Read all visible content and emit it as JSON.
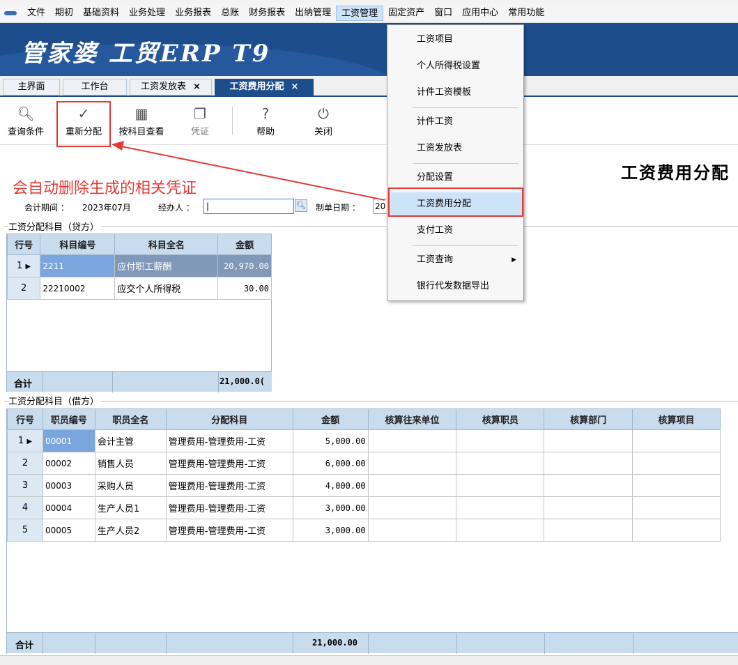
{
  "menubar": {
    "items": [
      "文件",
      "期初",
      "基础资料",
      "业务处理",
      "业务报表",
      "总账",
      "财务报表",
      "出纳管理",
      "工资管理",
      "固定资产",
      "窗口",
      "应用中心",
      "常用功能"
    ],
    "active": "工资管理"
  },
  "banner": {
    "brand": "管家婆 工贸ERP T9"
  },
  "tabs": [
    {
      "label": "主界面",
      "closable": false
    },
    {
      "label": "工作台",
      "closable": false
    },
    {
      "label": "工资发放表",
      "closable": true
    },
    {
      "label": "工资费用分配",
      "closable": true,
      "active": true
    }
  ],
  "tab_close_glyph": "×",
  "toolbar": {
    "query": "查询条件",
    "realloc": "重新分配",
    "by_subject": "按科目查看",
    "voucher": "凭证",
    "help": "帮助",
    "close": "关闭"
  },
  "page_title": "工资费用分配",
  "annotation": "会自动删除生成的相关凭证",
  "form": {
    "period_label": "会计期间 ：",
    "period_value": "2023年07月",
    "handler_label": "经办人 ：",
    "handler_value": "|",
    "date_label": "制单日期 ：",
    "date_value": "20"
  },
  "credit": {
    "title": "工资分配科目（贷方）",
    "headers": [
      "行号",
      "科目编号",
      "科目全名",
      "金额"
    ],
    "rows": [
      {
        "no": "1",
        "code": "2211",
        "name": "应付职工薪酬",
        "amount": "20,970.00"
      },
      {
        "no": "2",
        "code": "22210002",
        "name": "应交个人所得税",
        "amount": "30.00"
      }
    ],
    "total_label": "合计",
    "total_amount": "21,000.0("
  },
  "debit": {
    "title": "工资分配科目（借方）",
    "headers": [
      "行号",
      "职员编号",
      "职员全名",
      "分配科目",
      "金额",
      "核算往来单位",
      "核算职员",
      "核算部门",
      "核算项目"
    ],
    "rows": [
      {
        "no": "1",
        "code": "00001",
        "name": "会计主管",
        "subject": "管理费用-管理费用-工资",
        "amount": "5,000.00"
      },
      {
        "no": "2",
        "code": "00002",
        "name": "销售人员",
        "subject": "管理费用-管理费用-工资",
        "amount": "6,000.00"
      },
      {
        "no": "3",
        "code": "00003",
        "name": "采购人员",
        "subject": "管理费用-管理费用-工资",
        "amount": "4,000.00"
      },
      {
        "no": "4",
        "code": "00004",
        "name": "生产人员1",
        "subject": "管理费用-管理费用-工资",
        "amount": "3,000.00"
      },
      {
        "no": "5",
        "code": "00005",
        "name": "生产人员2",
        "subject": "管理费用-管理费用-工资",
        "amount": "3,000.00"
      }
    ],
    "total_label": "合计",
    "total_amount": "21,000.00"
  },
  "dropdown": {
    "items": [
      "工资项目",
      "个人所得税设置",
      "计件工资模板",
      "计件工资",
      "工资发放表",
      "分配设置",
      "工资费用分配",
      "支付工资",
      "工资查询",
      "银行代发数据导出"
    ],
    "highlighted": "工资费用分配"
  },
  "colors": {
    "accent": "#1e4d8c",
    "annotation_red": "#e53935",
    "grid_header": "#c8dcee",
    "selected_cell": "#7ba6dd"
  }
}
